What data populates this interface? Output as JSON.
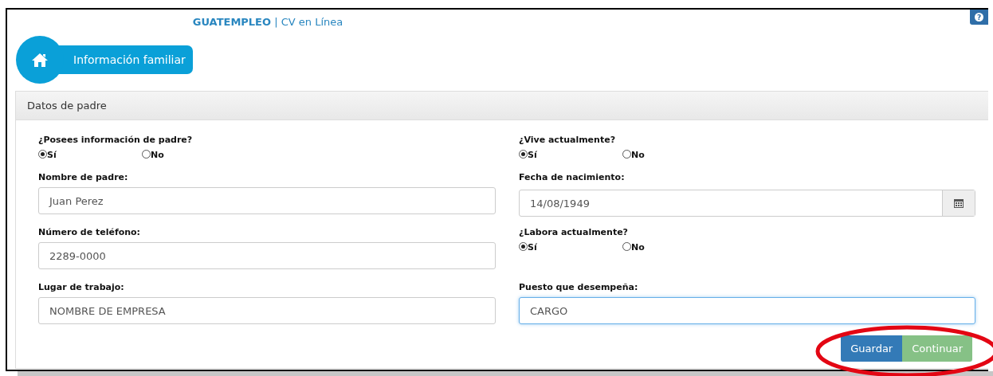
{
  "header": {
    "title": "**GUATEMPLEO** | CV en Línea",
    "help": "?"
  },
  "section_badge": {
    "label": "Información familiar"
  },
  "panel": {
    "title": "Datos de padre",
    "rows": [
      [
        {
          "kind": "radio",
          "label": "¿Posees información de padre?",
          "options": [
            {
              "label": "Sí",
              "selected": true
            },
            {
              "label": "No",
              "selected": false
            }
          ]
        },
        {
          "kind": "radio",
          "label": "¿Vive actualmente?",
          "options": [
            {
              "label": "Sí",
              "selected": true
            },
            {
              "label": "No",
              "selected": false
            }
          ]
        }
      ],
      [
        {
          "kind": "input",
          "label": "Nombre de padre:",
          "value": "Juan Perez",
          "focused": false
        },
        {
          "kind": "date",
          "label": "Fecha de nacimiento:",
          "value": "14/08/1949",
          "focused": false
        }
      ],
      [
        {
          "kind": "input",
          "label": "Número de teléfono:",
          "value": "2289-0000",
          "focused": false
        },
        {
          "kind": "radio",
          "label": "¿Labora actualmente?",
          "options": [
            {
              "label": "Sí",
              "selected": true
            },
            {
              "label": "No",
              "selected": false
            }
          ]
        }
      ],
      [
        {
          "kind": "input",
          "label": "Lugar de trabajo:",
          "value": "NOMBRE DE EMPRESA",
          "focused": false
        },
        {
          "kind": "input",
          "label": "Puesto que desempeña:",
          "value": "CARGO",
          "focused": true
        }
      ]
    ]
  },
  "buttons": [
    {
      "label": "Guardar",
      "kind": "primary"
    },
    {
      "label": "Continuar",
      "kind": "success"
    }
  ],
  "annotation": {
    "kind": "ellipse",
    "color": "#e30613"
  }
}
